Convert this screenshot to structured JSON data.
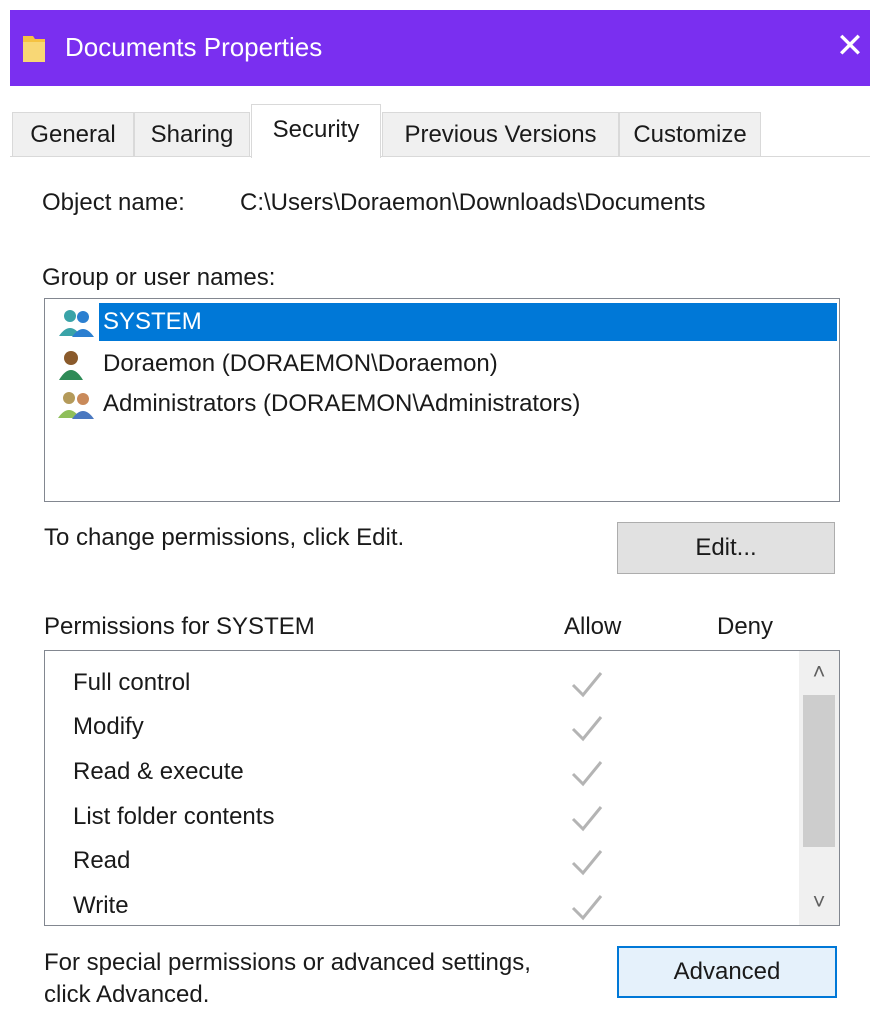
{
  "window": {
    "title": "Documents Properties",
    "folder_icon": "folder-icon",
    "close_glyph": "✕",
    "accent_color": "#7a2ff0"
  },
  "tabs": [
    {
      "label": "General",
      "active": false
    },
    {
      "label": "Sharing",
      "active": false
    },
    {
      "label": "Security",
      "active": true
    },
    {
      "label": "Previous Versions",
      "active": false
    },
    {
      "label": "Customize",
      "active": false
    }
  ],
  "object": {
    "label": "Object name:",
    "value": "C:\\Users\\Doraemon\\Downloads\\Documents"
  },
  "groups": {
    "label": "Group or user names:",
    "items": [
      {
        "name": "SYSTEM",
        "icon": "users-group-icon",
        "selected": true
      },
      {
        "name": "Doraemon (DORAEMON\\Doraemon)",
        "icon": "user-icon",
        "selected": false
      },
      {
        "name": "Administrators (DORAEMON\\Administrators)",
        "icon": "admin-group-icon",
        "selected": false
      }
    ],
    "selection_color": "#0078d7"
  },
  "edit": {
    "hint": "To change permissions, click Edit.",
    "button_label": "Edit..."
  },
  "permissions": {
    "title": "Permissions for SYSTEM",
    "allow_header": "Allow",
    "deny_header": "Deny",
    "rows": [
      {
        "name": "Full control",
        "allow": true,
        "deny": false
      },
      {
        "name": "Modify",
        "allow": true,
        "deny": false
      },
      {
        "name": "Read & execute",
        "allow": true,
        "deny": false
      },
      {
        "name": "List folder contents",
        "allow": true,
        "deny": false
      },
      {
        "name": "Read",
        "allow": true,
        "deny": false
      },
      {
        "name": "Write",
        "allow": true,
        "deny": false
      }
    ],
    "scroll_up_glyph": "˄",
    "scroll_down_glyph": "˅"
  },
  "advanced": {
    "hint_line1": "For special permissions or advanced settings,",
    "hint_line2": "click Advanced.",
    "button_label": "Advanced"
  }
}
